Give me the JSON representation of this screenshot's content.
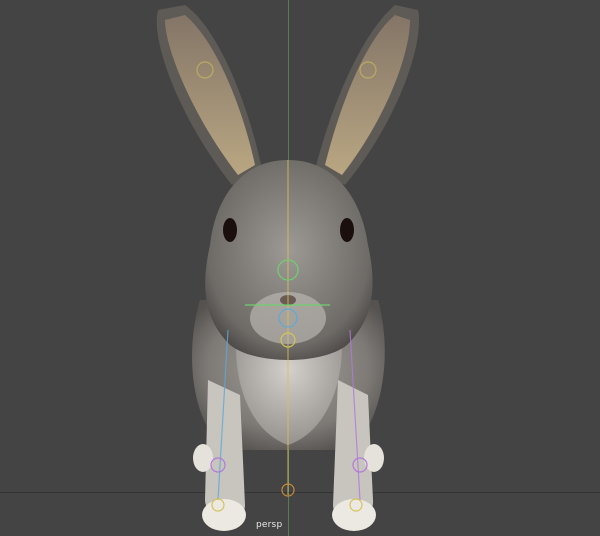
{
  "viewport": {
    "camera_label": "persp",
    "background_color": "#444444"
  },
  "model": {
    "subject": "rabbit",
    "fur_color": "#8f8c88",
    "rig_colors": [
      "#d4c35a",
      "#6fd06f",
      "#5fa8d8",
      "#b07ad8"
    ]
  }
}
